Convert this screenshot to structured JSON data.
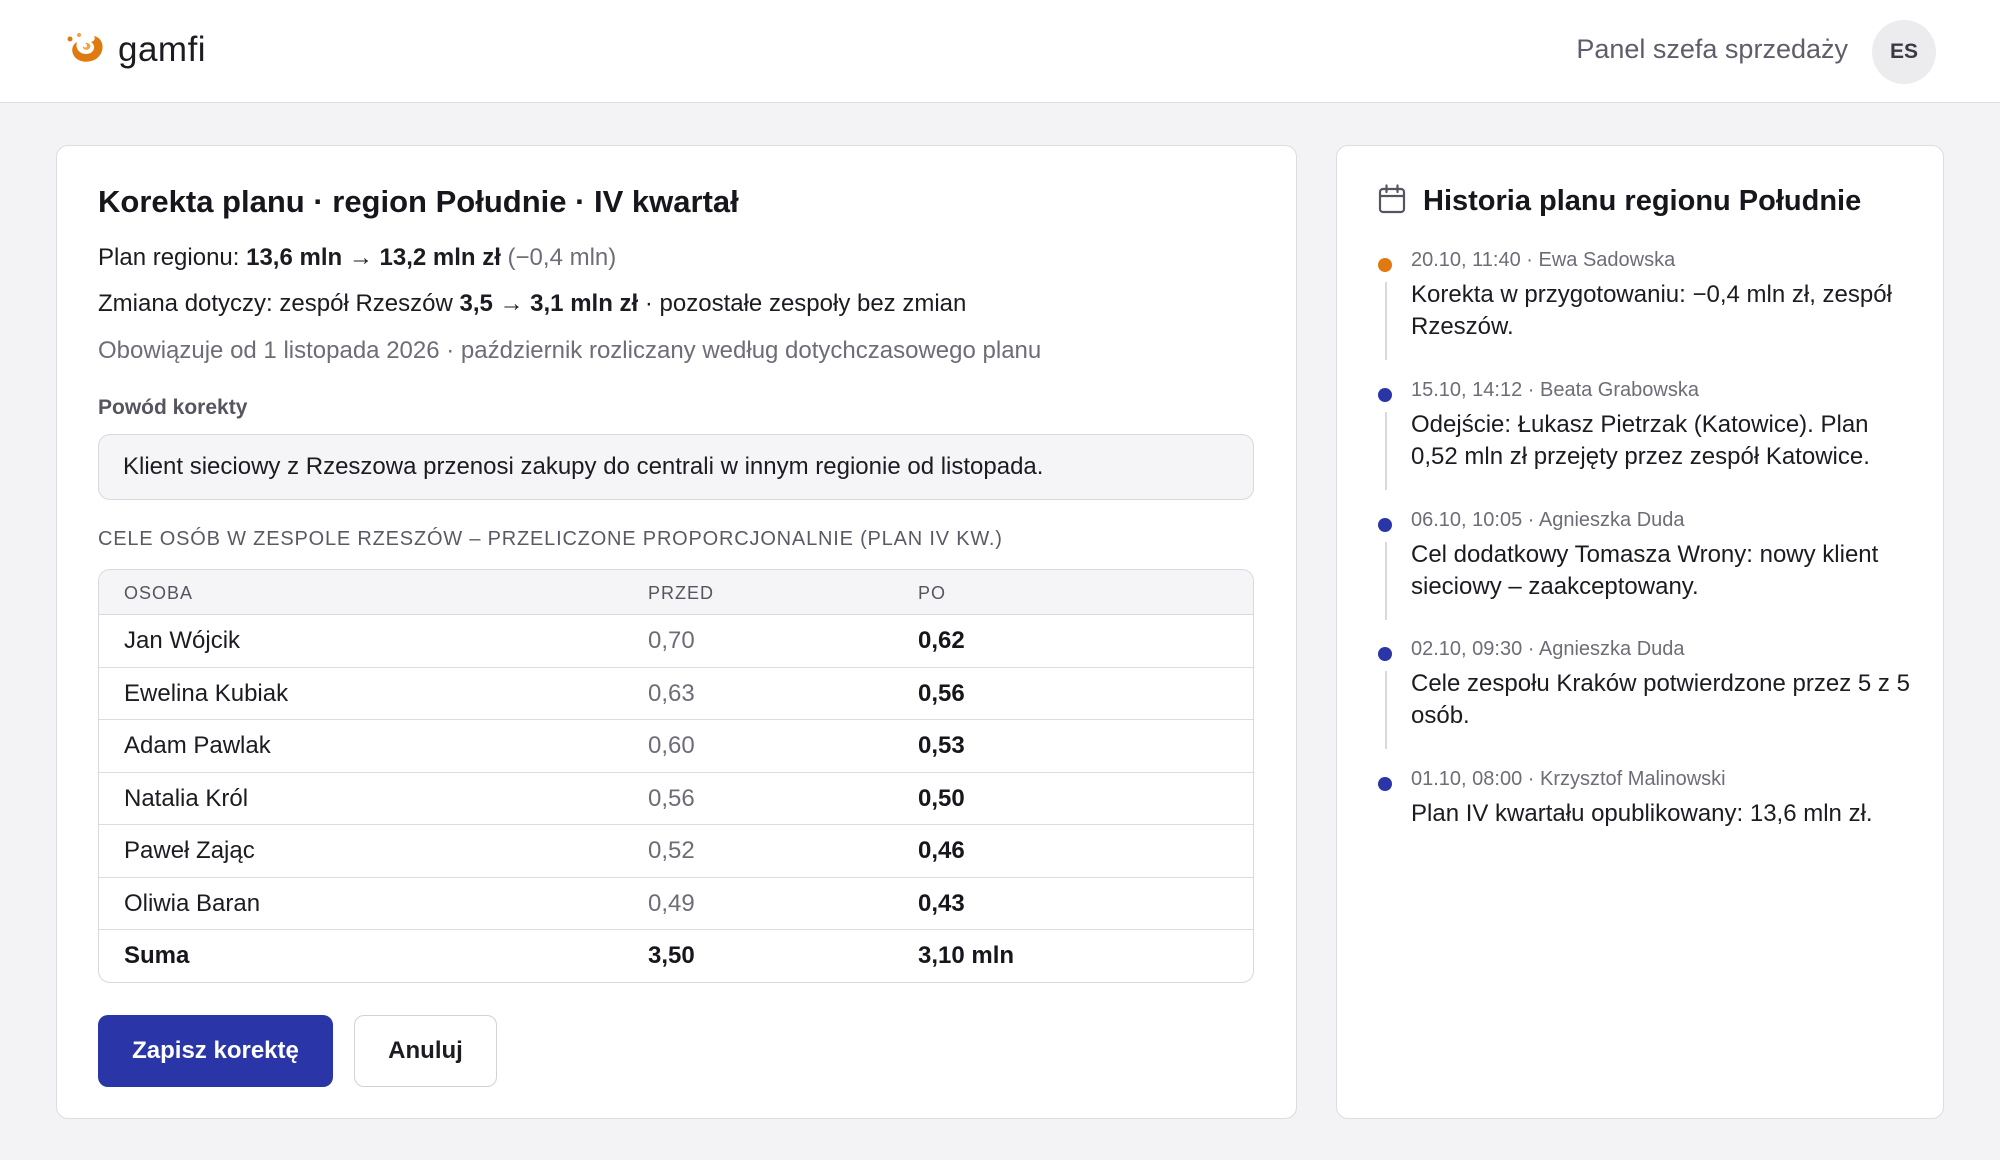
{
  "header": {
    "brand": "gamfi",
    "logo_icon": "flame-icon",
    "panel_title": "Panel szefa sprzedaży",
    "avatar_initials": "ES"
  },
  "colors": {
    "accent": "#2a36a8",
    "brand_orange": "#e07a10",
    "timeline_pending": "#e07a10",
    "timeline_done": "#2a36a8"
  },
  "correction": {
    "title": "Korekta planu · region Południe · IV kwartał",
    "plan_prefix": "Plan regionu: ",
    "plan_change": "13,6 mln → 13,2 mln zł",
    "plan_delta": " (−0,4 mln)",
    "scope_prefix": "Zmiana dotyczy: zespół Rzeszów ",
    "scope_change": "3,5 → 3,1 mln zł",
    "scope_suffix": " · pozostałe zespoły bez zmian",
    "effective": "Obowiązuje od 1 listopada 2026 · październik rozliczany według dotychczasowego planu",
    "reason_label": "Powód korekty",
    "reason_value": "Klient sieciowy z Rzeszowa przenosi zakupy do centrali w innym regionie od listopada.",
    "table_heading": "Cele osób w zespole Rzeszów – przeliczone proporcjonalnie (plan IV kw.)",
    "columns": [
      "Osoba",
      "Przed",
      "Po"
    ],
    "rows": [
      {
        "name": "Jan Wójcik",
        "before": "0,70",
        "after": "0,62"
      },
      {
        "name": "Ewelina Kubiak",
        "before": "0,63",
        "after": "0,56"
      },
      {
        "name": "Adam Pawlak",
        "before": "0,60",
        "after": "0,53"
      },
      {
        "name": "Natalia Król",
        "before": "0,56",
        "after": "0,50"
      },
      {
        "name": "Paweł Zając",
        "before": "0,52",
        "after": "0,46"
      },
      {
        "name": "Oliwia Baran",
        "before": "0,49",
        "after": "0,43"
      }
    ],
    "sum": {
      "label": "Suma",
      "before": "3,50",
      "after": "3,10 mln"
    },
    "save_label": "Zapisz korektę",
    "cancel_label": "Anuluj"
  },
  "history": {
    "icon": "calendar-icon",
    "title": "Historia planu regionu Południe",
    "items": [
      {
        "meta": "20.10, 11:40 · Ewa Sadowska",
        "text": "Korekta w przygotowaniu: −0,4 mln zł, zespół Rzeszów.",
        "status": "pending"
      },
      {
        "meta": "15.10, 14:12 · Beata Grabowska",
        "text": "Odejście: Łukasz Pietrzak (Katowice). Plan 0,52 mln zł przejęty przez zespół Katowice.",
        "status": "done"
      },
      {
        "meta": "06.10, 10:05 · Agnieszka Duda",
        "text": "Cel dodatkowy Tomasza Wrony: nowy klient sieciowy – zaakceptowany.",
        "status": "done"
      },
      {
        "meta": "02.10, 09:30 · Agnieszka Duda",
        "text": "Cele zespołu Kraków potwierdzone przez 5 z 5 osób.",
        "status": "done"
      },
      {
        "meta": "01.10, 08:00 · Krzysztof Malinowski",
        "text": "Plan IV kwartału opublikowany: 13,6 mln zł.",
        "status": "done"
      }
    ]
  }
}
